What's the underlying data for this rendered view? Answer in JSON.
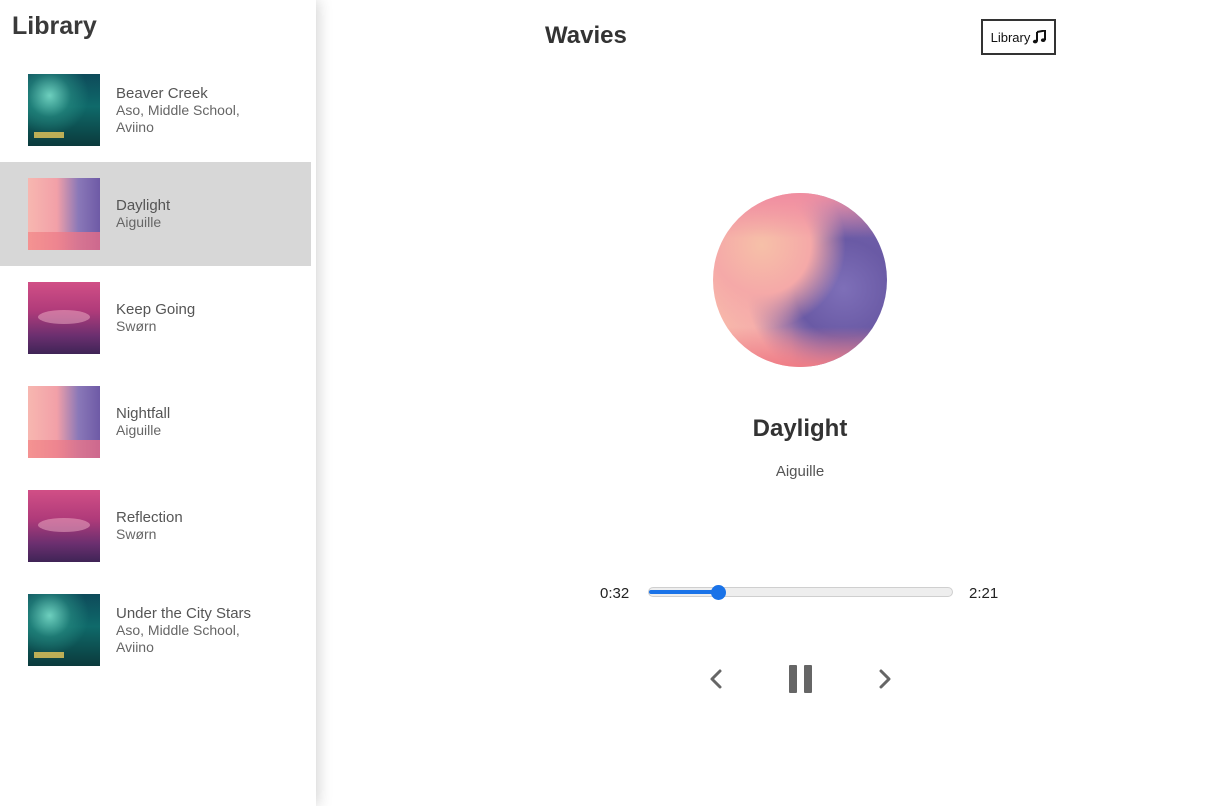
{
  "sidebar": {
    "title": "Library",
    "tracks": [
      {
        "name": "Beaver Creek",
        "artist": "Aso, Middle School, Aviino",
        "cover": "green"
      },
      {
        "name": "Daylight",
        "artist": "Aiguille",
        "cover": "pink",
        "active": true
      },
      {
        "name": "Keep Going",
        "artist": "Swørn",
        "cover": "purple"
      },
      {
        "name": "Nightfall",
        "artist": "Aiguille",
        "cover": "pink"
      },
      {
        "name": "Reflection",
        "artist": "Swørn",
        "cover": "purple"
      },
      {
        "name": "Under the City Stars",
        "artist": "Aso, Middle School, Aviino",
        "cover": "green"
      }
    ]
  },
  "header": {
    "app_title": "Wavies",
    "library_button_label": "Library",
    "library_button_icon": "music-note-icon"
  },
  "player": {
    "song_title": "Daylight",
    "song_artist": "Aiguille",
    "time_current": "0:32",
    "time_total": "2:21",
    "progress_fraction": 0.227,
    "accent_color": "#1a73e8",
    "controls": {
      "prev_icon": "chevron-left-icon",
      "play_pause_icon": "pause-icon",
      "next_icon": "chevron-right-icon"
    }
  }
}
